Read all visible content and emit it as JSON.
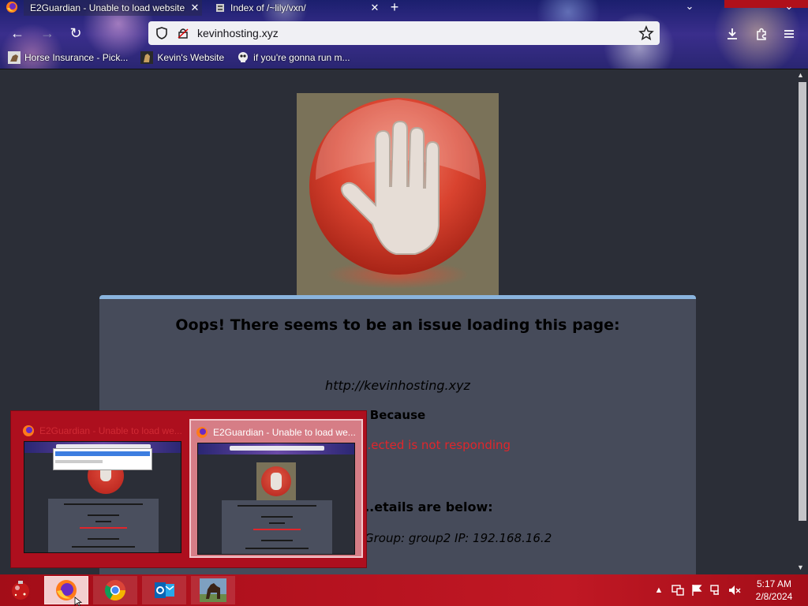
{
  "browser": {
    "tabs": [
      {
        "label": "E2Guardian - Unable to load website",
        "active": true
      },
      {
        "label": "Index of /~lily/vxn/",
        "active": false
      }
    ],
    "close_glyph": "✕",
    "new_tab_glyph": "+",
    "list_tabs_glyph": "⌄",
    "window_close_glyph": "⌄",
    "nav": {
      "back": "←",
      "forward": "→",
      "reload": "↻"
    },
    "url": "kevinhosting.xyz",
    "bookmarks": [
      {
        "label": "Horse Insurance - Pick...",
        "icon": "horse-bookmark-icon"
      },
      {
        "label": "Kevin's Website",
        "icon": "kevin-site-icon"
      },
      {
        "label": "if you're gonna run m...",
        "icon": "skull-bookmark-icon"
      }
    ],
    "toolbar_icons": [
      "download-icon",
      "extensions-icon",
      "menu-icon"
    ]
  },
  "page": {
    "heading": "Oops! There seems to be an issue loading this page:",
    "blocked_url": "http://kevinhosting.xyz",
    "because_label": "Because",
    "reason": "...ected is not responding",
    "details_label": "...etails are below:",
    "group_line": "Group: group2   IP: 192.168.16.2"
  },
  "previews": [
    {
      "title": "E2Guardian - Unable to load we...",
      "hover": false
    },
    {
      "title": "E2Guardian - Unable to load we...",
      "hover": true
    }
  ],
  "taskbar": {
    "apps": [
      "firefox-icon",
      "chrome-icon",
      "outlook-icon",
      "horse-app-icon"
    ],
    "time": "5:17 AM",
    "date": "2/8/2024"
  },
  "colors": {
    "accent_red": "#e0262b",
    "card_bg": "#464b5a",
    "card_border": "#8ab4de",
    "taskbar": "#b5121f"
  }
}
